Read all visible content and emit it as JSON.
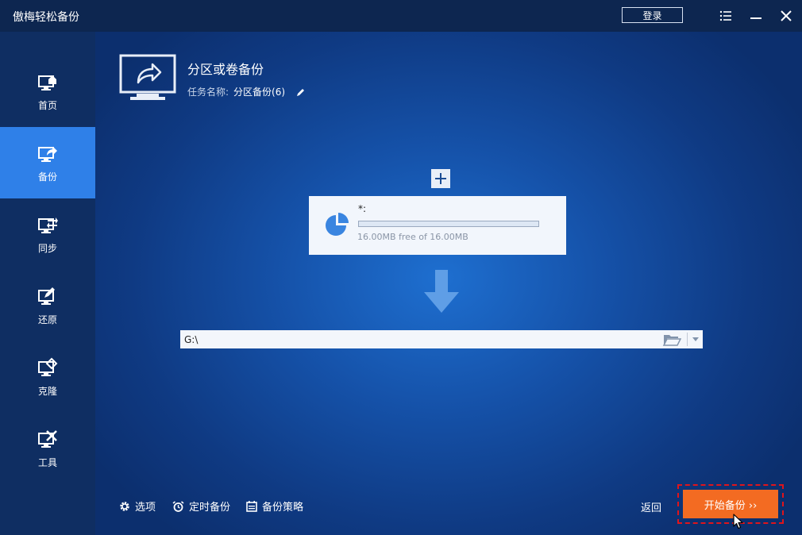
{
  "window": {
    "title": "傲梅轻松备份",
    "login_label": "登录"
  },
  "sidebar": {
    "items": [
      {
        "label": "首页",
        "icon": "home-monitor-icon"
      },
      {
        "label": "备份",
        "icon": "backup-monitor-icon",
        "active": true
      },
      {
        "label": "同步",
        "icon": "sync-monitor-icon"
      },
      {
        "label": "还原",
        "icon": "restore-monitor-icon"
      },
      {
        "label": "克隆",
        "icon": "clone-monitor-icon"
      },
      {
        "label": "工具",
        "icon": "tools-monitor-icon"
      }
    ]
  },
  "main": {
    "title": "分区或卷备份",
    "task_label": "任务名称:",
    "task_name": "分区备份(6)",
    "source": {
      "drive": "*:",
      "used_fraction": 0.0,
      "free_text": "16.00MB free of 16.00MB"
    },
    "destination": {
      "value": "G:\\"
    },
    "bottom": {
      "options_label": "选项",
      "schedule_label": "定时备份",
      "scheme_label": "备份策略",
      "back_label": "返回",
      "start_label": "开始备份 ››"
    }
  },
  "colors": {
    "accent": "#2f80e8",
    "start_button": "#f36b22",
    "highlight_border": "#e0141b"
  }
}
